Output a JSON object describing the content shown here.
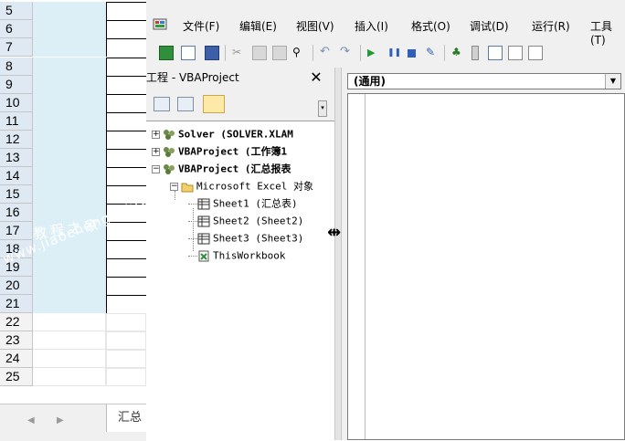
{
  "excel": {
    "rows": [
      "5",
      "6",
      "7",
      "8",
      "9",
      "10",
      "11",
      "12",
      "13",
      "14",
      "15",
      "16",
      "17",
      "18",
      "19",
      "20",
      "21",
      "22",
      "23",
      "24",
      "25"
    ],
    "sheet_tab": "汇总",
    "nav_prev": "◀",
    "nav_next": "▶"
  },
  "vbe": {
    "menu": [
      "文件(F)",
      "编辑(E)",
      "视图(V)",
      "插入(I)",
      "格式(O)",
      "调试(D)",
      "运行(R)",
      "工具(T)"
    ],
    "project_pane": {
      "title": "工程 - VBAProject",
      "close": "✕",
      "tree": [
        {
          "expander": "+",
          "label": "Solver (SOLVER.XLAM",
          "bold": true
        },
        {
          "expander": "+",
          "label": "VBAProject (工作簿1",
          "bold": true
        },
        {
          "expander": "−",
          "label": "VBAProject (汇总报表",
          "bold": true
        },
        {
          "expander": "−",
          "label": "Microsoft Excel 对象",
          "bold": false
        },
        {
          "expander": "",
          "label": "Sheet1 (汇总表)",
          "bold": false
        },
        {
          "expander": "",
          "label": "Sheet2 (Sheet2)",
          "bold": false
        },
        {
          "expander": "",
          "label": "Sheet3 (Sheet3)",
          "bold": false
        },
        {
          "expander": "",
          "label": "ThisWorkbook",
          "bold": false
        }
      ]
    },
    "code_window": {
      "object_combo": "(通用)",
      "combo_arrow": "▼"
    },
    "resize_cursor": "⇹"
  },
  "watermark": {
    "line1": "www.jiaochengzhijia.com",
    "line2": "教程之家"
  },
  "colors": {
    "selection_fill": "#dceef6",
    "header_selected": "#dfe9f3",
    "vbe_background": "#f0f0f0"
  }
}
